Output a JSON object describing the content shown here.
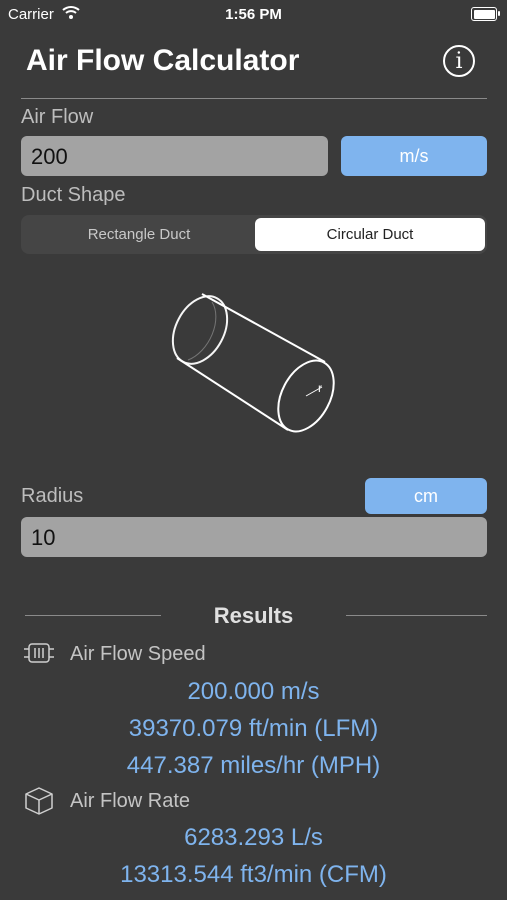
{
  "status_bar": {
    "carrier": "Carrier",
    "time": "1:56 PM"
  },
  "header": {
    "title": "Air Flow Calculator",
    "info_icon": "info-icon"
  },
  "air_flow": {
    "label": "Air Flow",
    "value": "200",
    "unit": "m/s"
  },
  "duct_shape": {
    "label": "Duct Shape",
    "options": [
      "Rectangle Duct",
      "Circular Duct"
    ],
    "selected": "Circular Duct"
  },
  "diagram": {
    "radius_marker": "r"
  },
  "radius": {
    "label": "Radius",
    "value": "10",
    "unit": "cm"
  },
  "results": {
    "title": "Results",
    "speed": {
      "label": "Air Flow Speed",
      "icon": "duct-speed-icon",
      "values": [
        "200.000 m/s",
        "39370.079 ft/min (LFM)",
        "447.387 miles/hr (MPH)"
      ]
    },
    "rate": {
      "label": "Air Flow Rate",
      "icon": "cube-icon",
      "values": [
        "6283.293 L/s",
        "13313.544 ft3/min (CFM)"
      ]
    }
  },
  "colors": {
    "accent": "#7fb4ee",
    "background": "#3a3a3a",
    "field": "#a3a3a3"
  }
}
